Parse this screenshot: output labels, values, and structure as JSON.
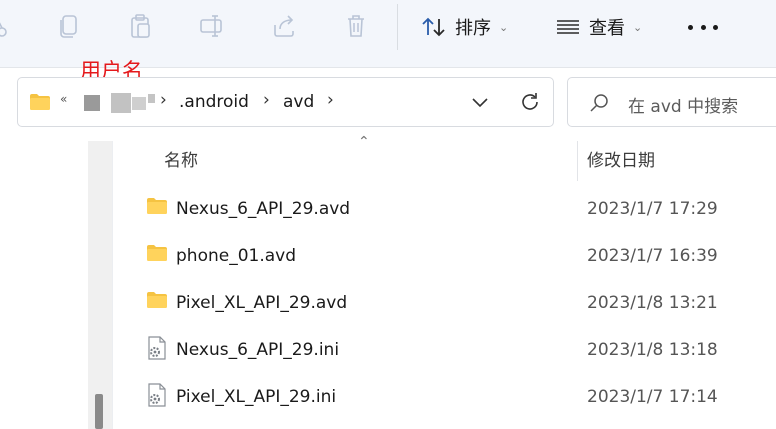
{
  "toolbar": {
    "sort_label": "排序",
    "view_label": "查看",
    "icons": [
      "cut-icon",
      "copy-icon",
      "paste-icon",
      "rename-icon",
      "share-icon",
      "delete-icon",
      "sort-icon",
      "view-icon",
      "more-icon"
    ]
  },
  "annotation": {
    "text": "用户名"
  },
  "address": {
    "breadcrumbs": [
      ".android",
      "avd"
    ]
  },
  "search": {
    "placeholder": "在 avd 中搜索"
  },
  "columns": {
    "name": "名称",
    "modified": "修改日期"
  },
  "files": [
    {
      "name": "Nexus_6_API_29.avd",
      "date": "2023/1/7 17:29",
      "type": "folder"
    },
    {
      "name": "phone_01.avd",
      "date": "2023/1/7 16:39",
      "type": "folder"
    },
    {
      "name": "Pixel_XL_API_29.avd",
      "date": "2023/1/8 13:21",
      "type": "folder"
    },
    {
      "name": "Nexus_6_API_29.ini",
      "date": "2023/1/8 13:18",
      "type": "ini"
    },
    {
      "name": "Pixel_XL_API_29.ini",
      "date": "2023/1/7 17:14",
      "type": "ini"
    }
  ],
  "colors": {
    "folder": "#f5c342",
    "annotation": "#e4191c",
    "toolbar_bg": "#f3f6fb"
  }
}
